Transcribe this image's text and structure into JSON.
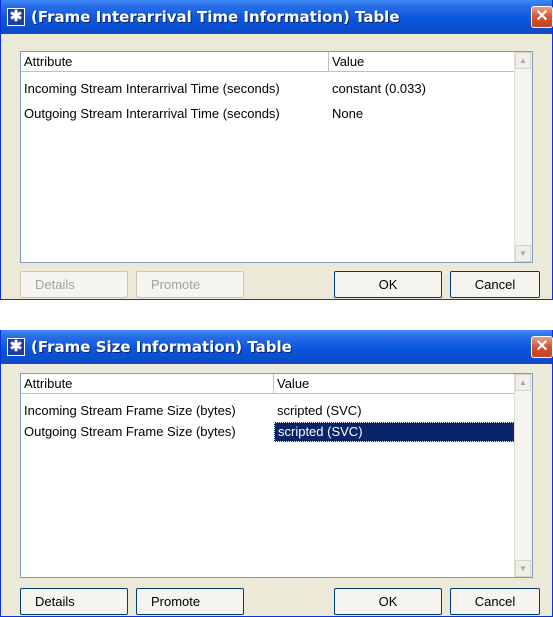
{
  "dialog1": {
    "title": "(Frame Interarrival Time Information) Table",
    "icon": "asterisk-icon",
    "close": "✕",
    "columns": [
      "Attribute",
      "Value"
    ],
    "rows": [
      {
        "attribute": "Incoming Stream Interarrival Time (seconds)",
        "value": "constant (0.033)"
      },
      {
        "attribute": "Outgoing Stream Interarrival Time (seconds)",
        "value": "None"
      }
    ],
    "buttons": {
      "details": "Details",
      "promote": "Promote",
      "ok": "OK",
      "cancel": "Cancel"
    }
  },
  "dialog2": {
    "title": "(Frame Size Information) Table",
    "icon": "asterisk-icon",
    "close": "✕",
    "columns": [
      "Attribute",
      "Value"
    ],
    "rows": [
      {
        "attribute": "Incoming Stream Frame Size (bytes)",
        "value": "scripted (SVC)"
      },
      {
        "attribute": "Outgoing Stream Frame Size (bytes)",
        "value": "scripted (SVC)",
        "selected": true
      }
    ],
    "buttons": {
      "details": "Details",
      "promote": "Promote",
      "ok": "OK",
      "cancel": "Cancel"
    }
  },
  "colors": {
    "titlebar": "#0a4fd0",
    "dialog_bg": "#ece9d8",
    "selection": "#0a246a"
  }
}
